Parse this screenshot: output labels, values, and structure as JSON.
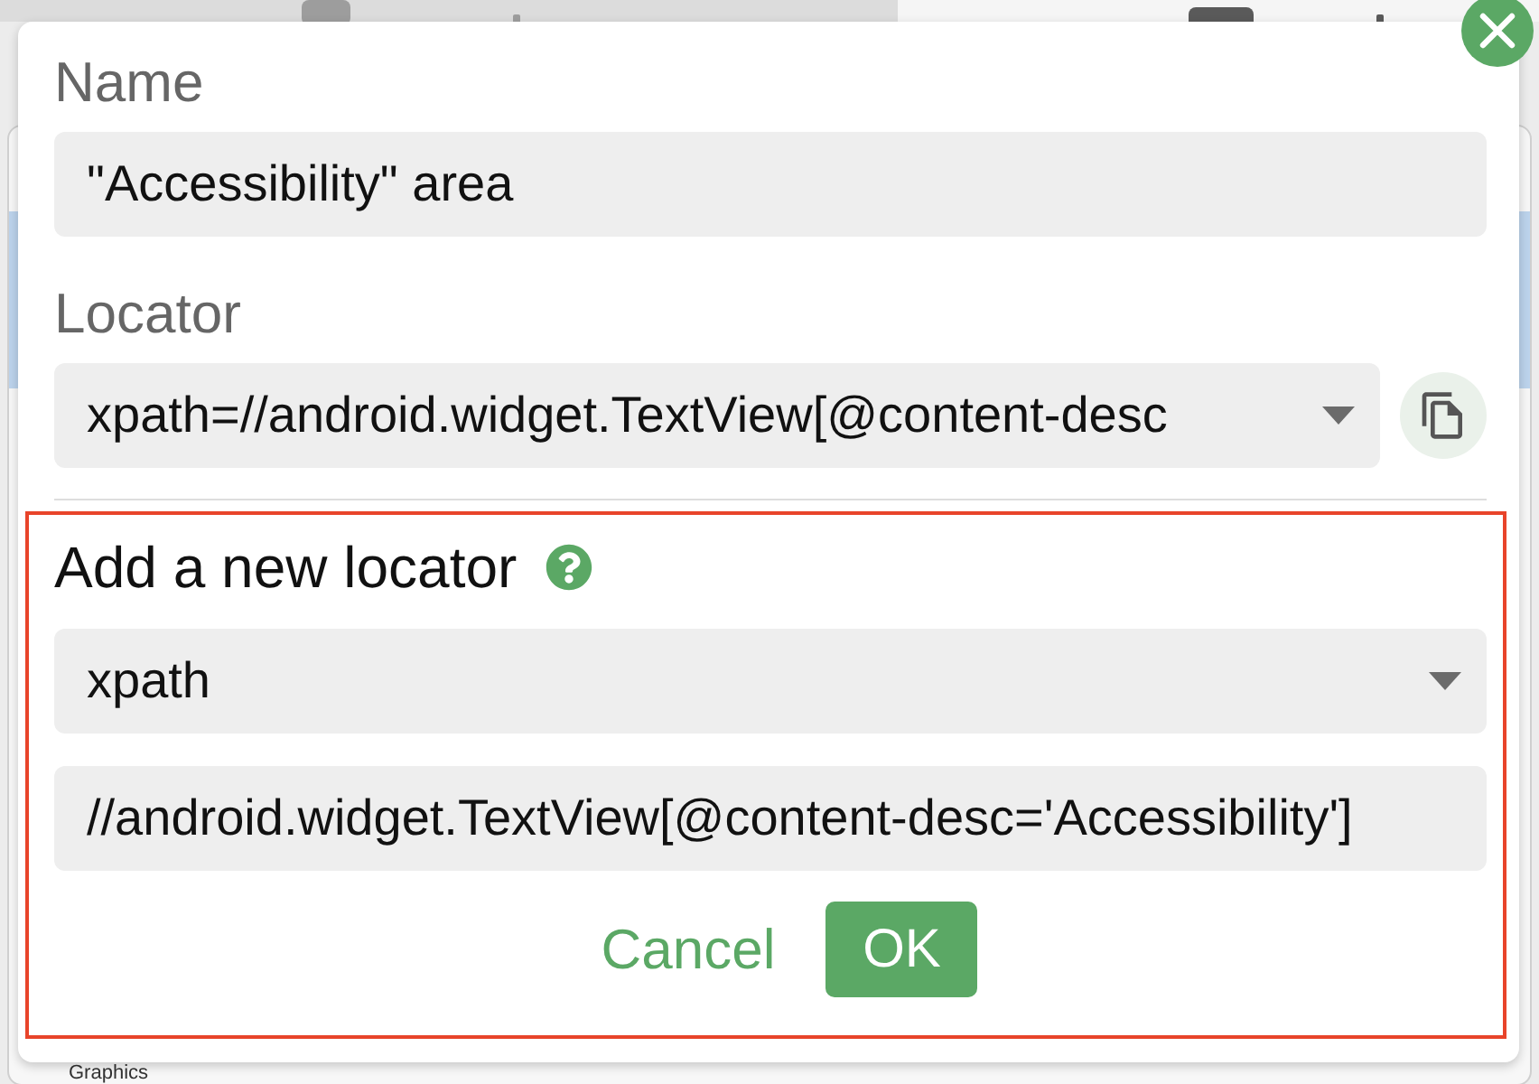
{
  "background": {
    "list_items": [
      "Graphics"
    ]
  },
  "dialog": {
    "fields": [
      {
        "kind": "text",
        "label": "Name",
        "value": "\"Accessibility\" area"
      },
      {
        "kind": "locator",
        "label": "Locator",
        "value": "xpath=//android.widget.TextView[@content-desc"
      }
    ],
    "new_locator": {
      "heading": "Add a new locator",
      "highlighted": true,
      "fields": [
        {
          "kind": "select",
          "value": "xpath"
        },
        {
          "kind": "text",
          "value": "//android.widget.TextView[@content-desc='Accessibility']"
        }
      ],
      "buttons": [
        {
          "kind": "link",
          "label": "Cancel"
        },
        {
          "kind": "primary",
          "label": "OK"
        }
      ]
    }
  }
}
